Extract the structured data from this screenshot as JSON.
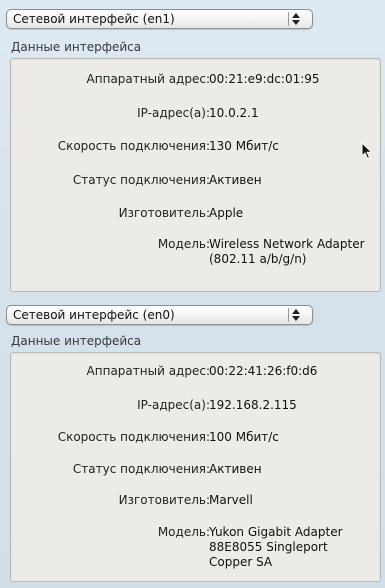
{
  "sections": [
    {
      "popup_label": "Сетевой интерфейс (en1)",
      "group_title": "Данные интерфейса",
      "rows": [
        {
          "label": "Аппаратный адрес:",
          "value": "00:21:e9:dc:01:95"
        },
        {
          "label": "IP-адрес(а):",
          "value": "10.0.2.1"
        },
        {
          "label": "Скорость подключения:",
          "value": "130 Мбит/с"
        },
        {
          "label": "Статус подключения:",
          "value": "Активен"
        },
        {
          "label": "Изготовитель:",
          "value": "Apple"
        },
        {
          "label": "Модель:",
          "value": "Wireless Network Adapter (802.11 a/b/g/n)"
        }
      ]
    },
    {
      "popup_label": "Сетевой интерфейс (en0)",
      "group_title": "Данные интерфейса",
      "rows": [
        {
          "label": "Аппаратный адрес:",
          "value": "00:22:41:26:f0:d6"
        },
        {
          "label": "IP-адрес(а):",
          "value": "192.168.2.115"
        },
        {
          "label": "Скорость подключения:",
          "value": "100 Мбит/с"
        },
        {
          "label": "Статус подключения:",
          "value": "Активен"
        },
        {
          "label": "Изготовитель:",
          "value": "Marvell"
        },
        {
          "label": "Модель:",
          "value": "Yukon Gigabit Adapter 88E8055 Singleport Copper SA"
        }
      ]
    }
  ]
}
